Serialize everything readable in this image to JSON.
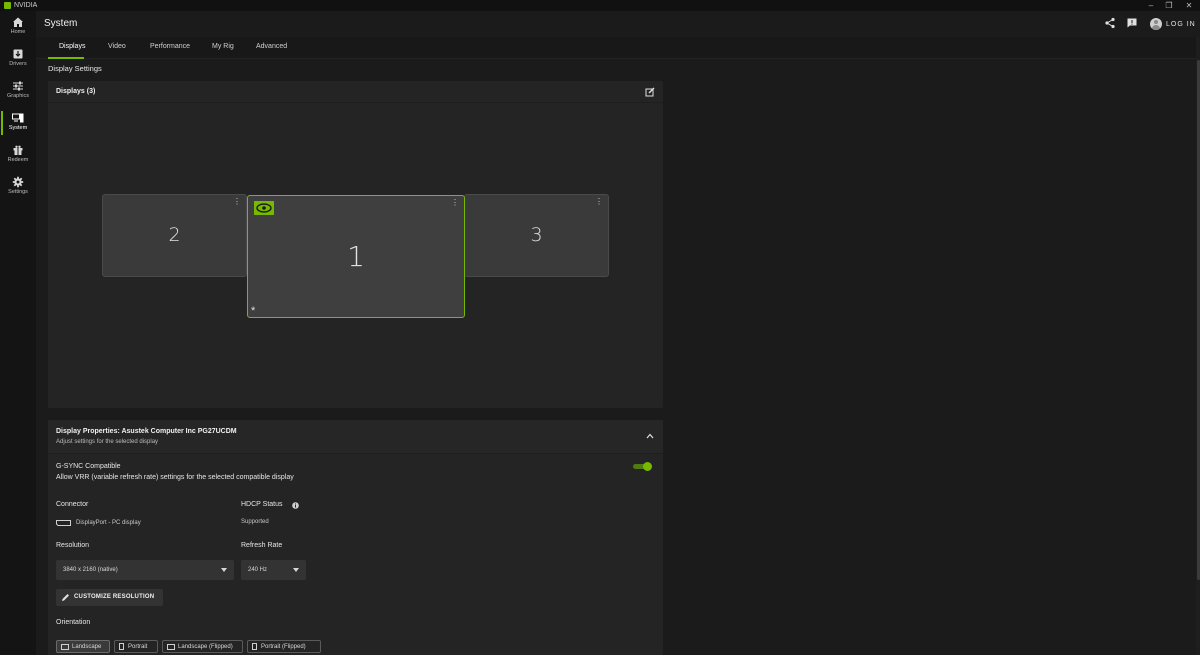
{
  "app": {
    "title": "NVIDIA",
    "brand_color": "#76b900"
  },
  "window_controls": {
    "minimize": "‒",
    "restore": "❐",
    "close": "✕"
  },
  "nav": {
    "items": [
      {
        "label": "Home",
        "icon": "home-icon"
      },
      {
        "label": "Drivers",
        "icon": "drivers-icon"
      },
      {
        "label": "Graphics",
        "icon": "sliders-icon"
      },
      {
        "label": "System",
        "icon": "system-icon",
        "active": true
      },
      {
        "label": "Redeem",
        "icon": "gift-icon"
      },
      {
        "label": "Settings",
        "icon": "gear-icon"
      }
    ]
  },
  "header": {
    "title": "System",
    "login_label": "LOG IN",
    "icons": [
      "share-icon",
      "feedback-icon",
      "avatar-icon"
    ]
  },
  "tabs": [
    {
      "label": "Displays",
      "active": true
    },
    {
      "label": "Video"
    },
    {
      "label": "Performance"
    },
    {
      "label": "My Rig"
    },
    {
      "label": "Advanced"
    }
  ],
  "section_title": "Display Settings",
  "displays_card": {
    "title": "Displays (3)",
    "monitors": [
      {
        "number": "2",
        "menu": "⋮"
      },
      {
        "number": "1",
        "menu": "⋮",
        "selected": true,
        "primary_mark": "*"
      },
      {
        "number": "3",
        "menu": "⋮"
      }
    ]
  },
  "properties": {
    "title": "Display Properties: Asustek Computer Inc PG27UCDM",
    "subtitle": "Adjust settings for the selected display",
    "gsync": {
      "label": "G-SYNC Compatible",
      "description": "Allow VRR (variable refresh rate) settings for the selected compatible display",
      "enabled": true
    },
    "connector": {
      "label": "Connector",
      "value": "DisplayPort - PC display"
    },
    "hdcp": {
      "label": "HDCP Status",
      "value": "Supported"
    },
    "resolution": {
      "label": "Resolution",
      "value": "3840 x 2160 (native)"
    },
    "refresh_rate": {
      "label": "Refresh Rate",
      "value": "240 Hz"
    },
    "customize_button": "CUSTOMIZE RESOLUTION",
    "orientation": {
      "label": "Orientation",
      "options": [
        "Landscape",
        "Portrait",
        "Landscape (Flipped)",
        "Portrait (Flipped)"
      ],
      "selected": "Landscape"
    }
  }
}
